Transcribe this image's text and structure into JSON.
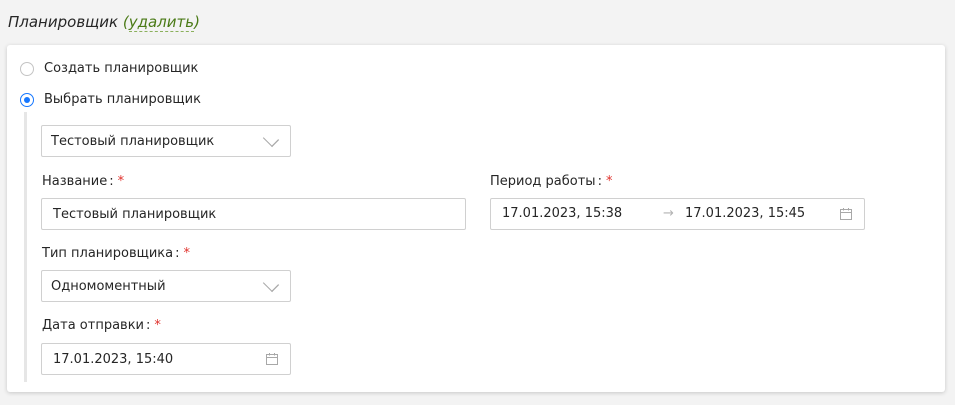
{
  "section": {
    "title": "Планировщик",
    "delete_link": "удалить"
  },
  "mode_options": [
    {
      "label": "Создать планировщик",
      "selected": false
    },
    {
      "label": "Выбрать планировщик",
      "selected": true
    }
  ],
  "scheduler_select": {
    "value": "Тестовый планировщик"
  },
  "name_field": {
    "label": "Название",
    "value": "Тестовый планировщик",
    "required": true
  },
  "period_field": {
    "label": "Период работы",
    "from": "17.01.2023, 15:38",
    "arrow": "→",
    "to": "17.01.2023, 15:45",
    "required": true
  },
  "type_field": {
    "label": "Тип планировщика",
    "value": "Одномоментный",
    "required": true
  },
  "send_date_field": {
    "label": "Дата отправки",
    "value": "17.01.2023, 15:40",
    "required": true
  },
  "required_mark": "*",
  "colors": {
    "accent": "#1677ff",
    "link": "#4a7a16",
    "required": "#e0302b",
    "page_bg": "#f3f3f3"
  },
  "icons": {
    "dropdown": "chevron-down-icon",
    "date": "calendar-icon"
  }
}
